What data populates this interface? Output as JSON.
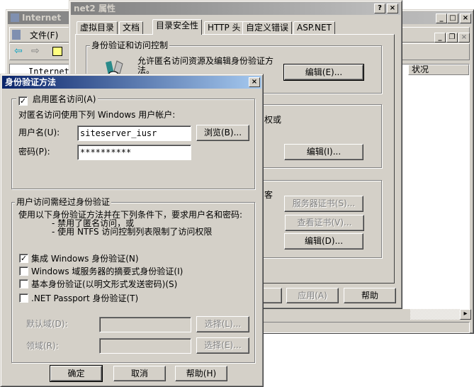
{
  "mmc": {
    "title": "Internet",
    "menu_file": "文件(F)",
    "tree_item": "Internet",
    "column_status": "状况"
  },
  "props": {
    "title": "net2 属性",
    "tabs": [
      "虚拟目录",
      "文档",
      "目录安全性",
      "HTTP 头",
      "自定义错误",
      "ASP.NET"
    ],
    "selected_tab": "目录安全性",
    "group_auth": "身份验证和访问控制",
    "auth_desc": "允许匿名访问资源及编辑身份验证方法。",
    "auth_desc_line1": "允许匿名访问资源及编辑身份验证方",
    "auth_desc_line2": "法。",
    "edit_auth": "编辑(E)...",
    "ip_text": "权或",
    "edit_ip": "编辑(I)...",
    "secure_text": "客",
    "server_cert": "服务器证书(S)...",
    "view_cert": "查看证书(V)...",
    "edit_secure": "编辑(D)...",
    "apply": "应用(A)",
    "help": "帮助"
  },
  "auth": {
    "title": "身份验证方法",
    "anon_enabled_label": "启用匿名访问(A)",
    "anon_enabled": true,
    "anon_desc": "对匿名访问使用下列 Windows 用户帐户:",
    "username_label": "用户名(U):",
    "username": "siteserver_iusr",
    "password_label": "密码(P):",
    "password": "**********",
    "browse": "浏览(B)...",
    "group_auth": "用户访问需经过身份验证",
    "desc1": "使用以下身份验证方法并在下列条件下，要求用户名和密码:",
    "desc2": "- 禁用了匿名访问，或",
    "desc3": "- 使用 NTFS 访问控制列表限制了访问权限",
    "methods": [
      {
        "label": "集成 Windows 身份验证(N)",
        "checked": true
      },
      {
        "label": "Windows 域服务器的摘要式身份验证(I)",
        "checked": false
      },
      {
        "label": "基本身份验证(以明文形式发送密码)(S)",
        "checked": false
      },
      {
        "label": ".NET Passport 身份验证(T)",
        "checked": false
      }
    ],
    "default_domain_label": "默认域(D):",
    "realm_label": "领域(R):",
    "select1": "选择(L)...",
    "select2": "选择(E)...",
    "ok": "确定",
    "cancel": "取消",
    "help": "帮助(H)"
  }
}
